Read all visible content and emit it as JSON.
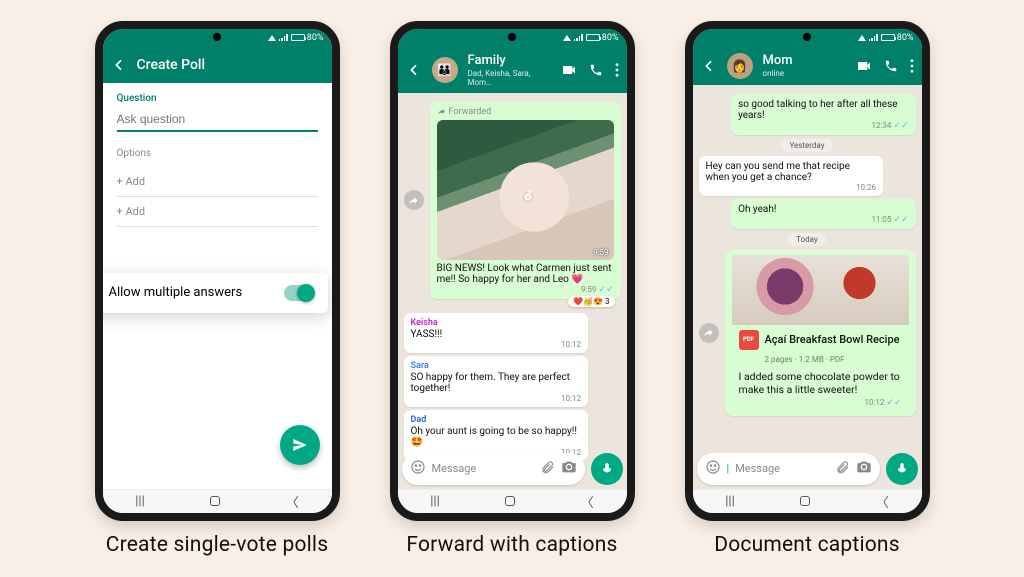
{
  "status": {
    "battery": "80%",
    "signal_bars": 4
  },
  "captions": [
    "Create single-vote polls",
    "Forward with captions",
    "Document captions"
  ],
  "colors": {
    "teal": "#008069",
    "accent": "#00a884",
    "bubble_out": "#d9fdd3",
    "chat_bg": "#ece5dd"
  },
  "poll": {
    "header": "Create Poll",
    "question_label": "Question",
    "question_placeholder": "Ask question",
    "options_label": "Options",
    "add_label": "+ Add",
    "toggle_label": "Allow multiple answers",
    "toggle_on": true
  },
  "chat_family": {
    "title": "Family",
    "subtitle": "Dad, Keisha, Sara, Mom…",
    "forwarded_label": "Forwarded",
    "image_time": "9:59",
    "caption_msg": "BIG NEWS! Look what Carmen just sent me!! So happy for her and Leo 💗",
    "caption_time": "9:59",
    "reactions": "❤️🥳😍 3",
    "replies": [
      {
        "sender": "Keisha",
        "sender_color": "#c026d3",
        "text": "YASS!!!",
        "time": "10:12"
      },
      {
        "sender": "Sara",
        "sender_color": "#3b82f6",
        "text": "SO happy for them. They are perfect together!",
        "time": "10:12"
      },
      {
        "sender": "Dad",
        "sender_color": "#2563eb",
        "text": "Oh your aunt is going to be so happy!! 🤩",
        "time": "10:12"
      }
    ],
    "input_placeholder": "Message"
  },
  "chat_mom": {
    "title": "Mom",
    "subtitle": "online",
    "msgs": [
      {
        "dir": "out",
        "text": "so good talking to her after all these years!",
        "time": "12:34"
      },
      {
        "sys": "Yesterday"
      },
      {
        "dir": "in",
        "text": "Hey can you send me that recipe when you get a chance?",
        "time": "10:26"
      },
      {
        "dir": "out",
        "text": "Oh yeah!",
        "time": "11:05"
      },
      {
        "sys": "Today"
      }
    ],
    "doc": {
      "title": "Açaí Breakfast Bowl Recipe",
      "meta": "2 pages · 1.2 MB · PDF",
      "pdf_label": "PDF",
      "caption": "I added some chocolate powder to make this a little sweeter!",
      "time": "10:12"
    },
    "input_placeholder": "Message"
  }
}
